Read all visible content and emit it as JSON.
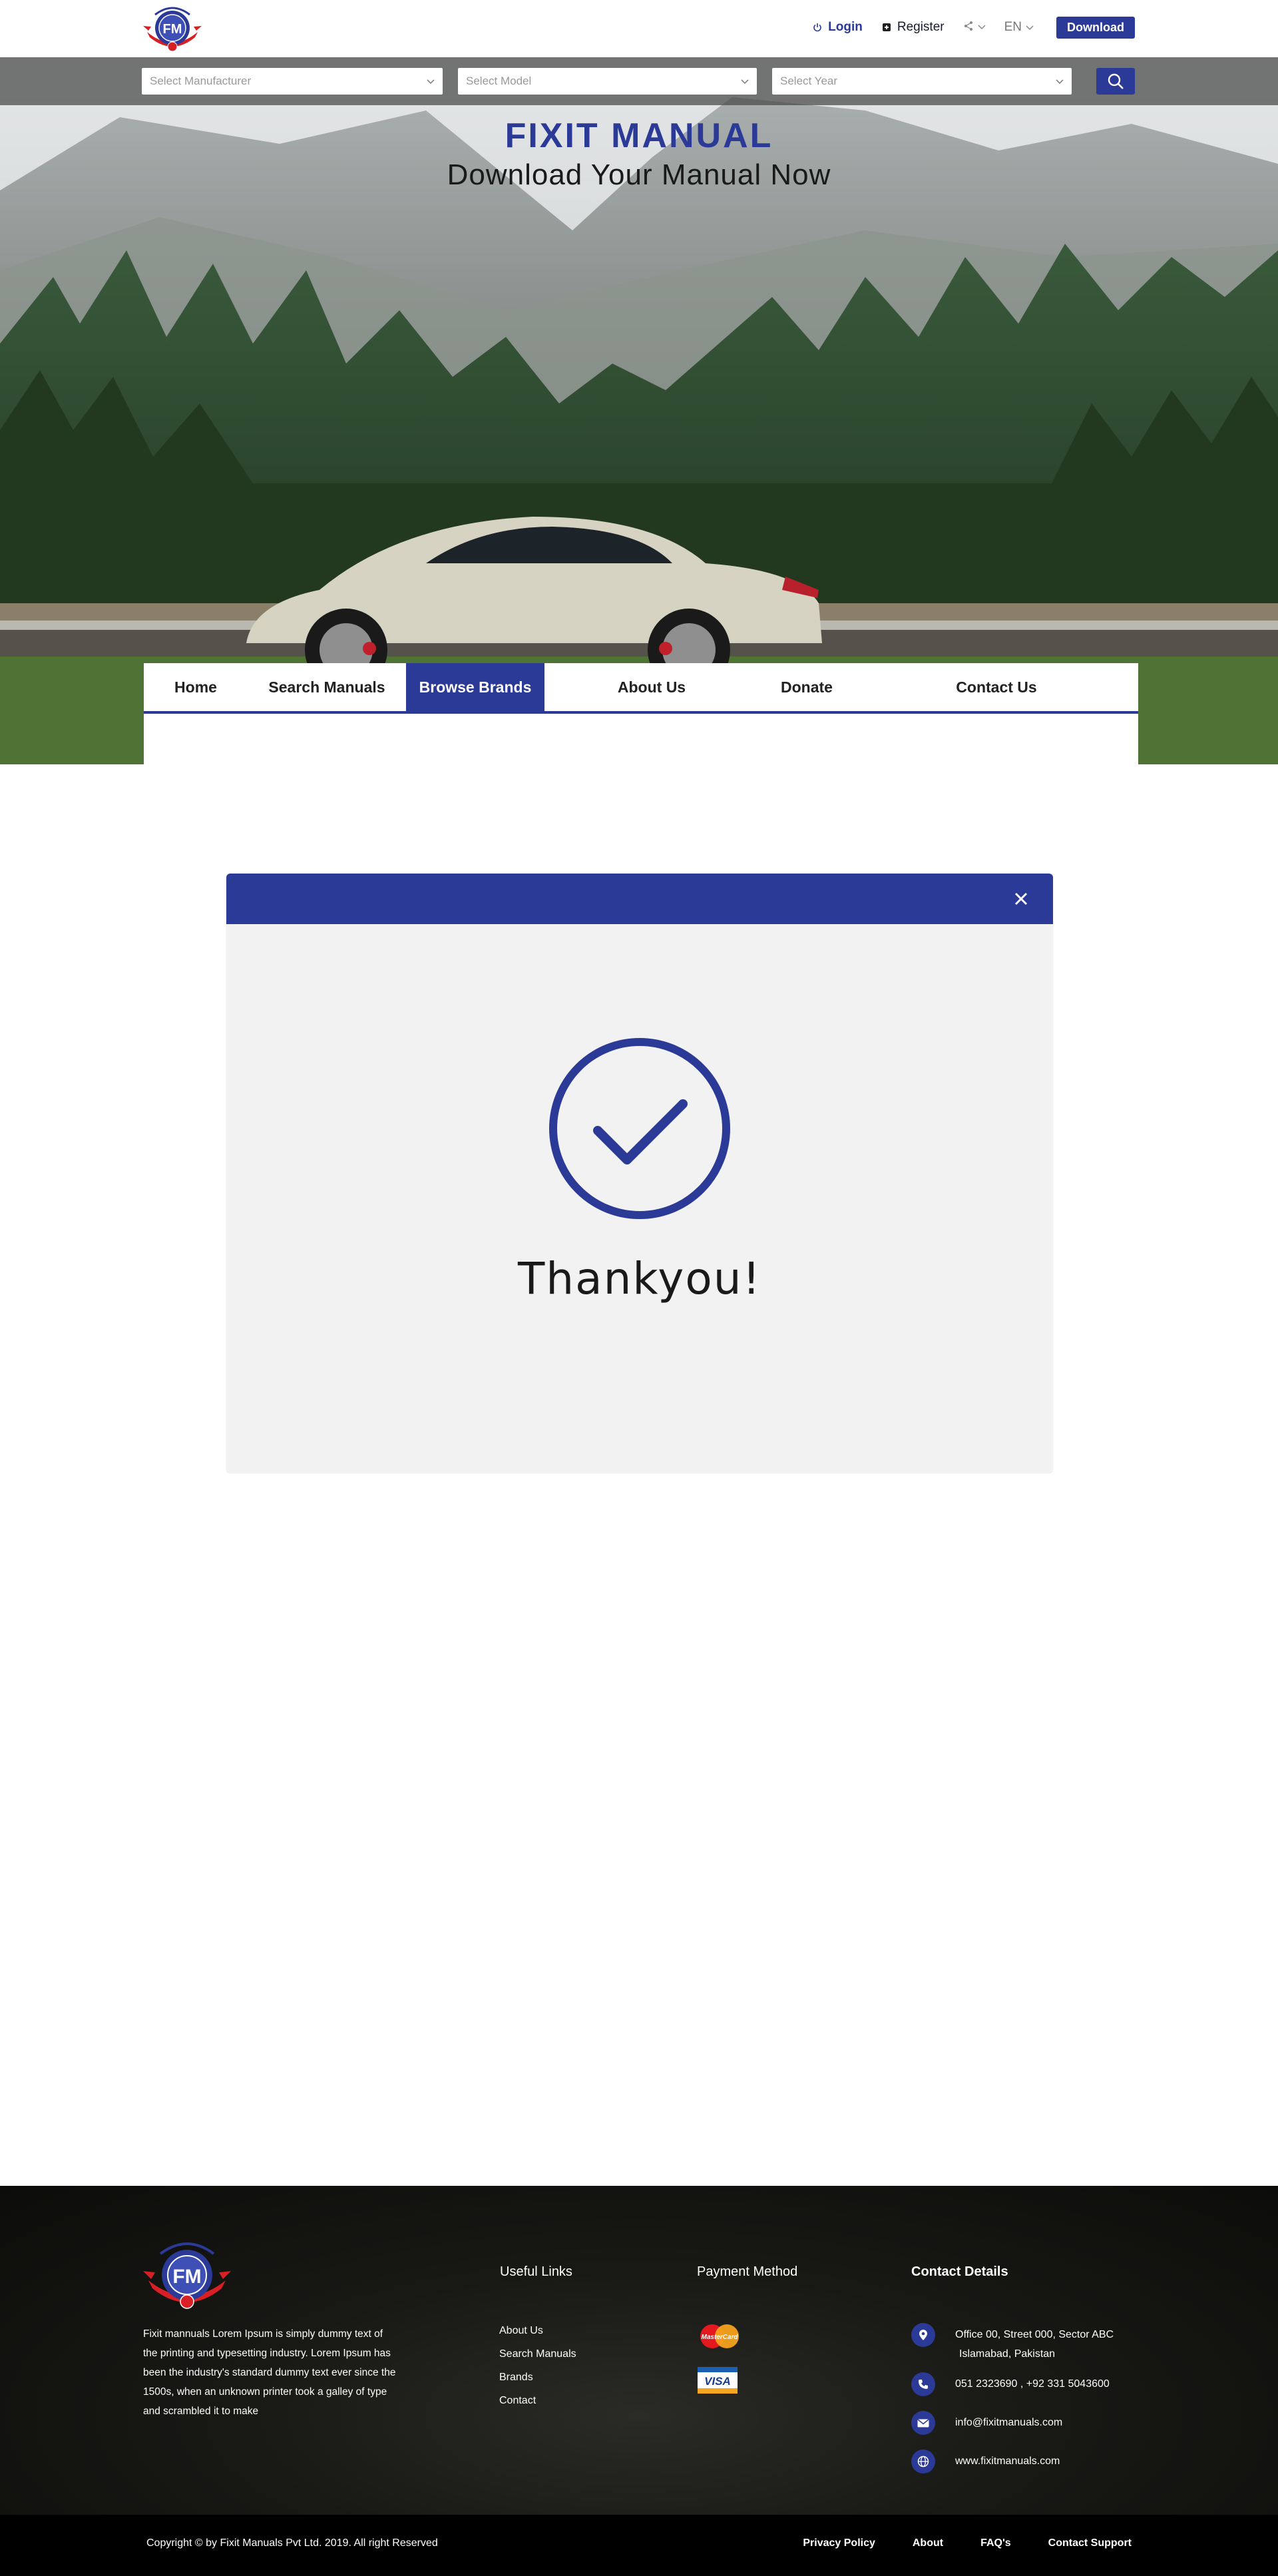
{
  "header": {
    "logo_alt": "Fixit Manuals",
    "login_label": "Login",
    "register_label": "Register",
    "language": "EN",
    "download_label": "Download"
  },
  "search": {
    "manufacturer_placeholder": "Select Manufacturer",
    "model_placeholder": "Select Model",
    "year_placeholder": "Select Year"
  },
  "hero": {
    "title": "FIXIT MANUAL",
    "subtitle": "Download Your Manual Now"
  },
  "nav": {
    "items": [
      {
        "label": "Home"
      },
      {
        "label": "Search Manuals"
      },
      {
        "label": "Browse Brands"
      },
      {
        "label": "About Us"
      },
      {
        "label": "Donate"
      },
      {
        "label": "Contact Us"
      }
    ],
    "active": "Browse Brands"
  },
  "modal": {
    "message": "Thankyou!"
  },
  "footer": {
    "about": "Fixit mannuals Lorem Ipsum is simply dummy text of the printing and typesetting industry. Lorem Ipsum has been the industry's standard dummy text ever since the 1500s, when an unknown printer took a galley of type and scrambled it to make",
    "useful_links_title": "Useful Links",
    "useful_links": [
      "About Us",
      "Search Manuals",
      "Brands",
      "Contact"
    ],
    "payment_title": "Payment Method",
    "payment_methods": [
      "MasterCard",
      "VISA"
    ],
    "contact_title": "Contact Details",
    "address_line1": "Office 00, Street 000, Sector ABC",
    "address_line2": "Islamabad, Pakistan",
    "phone": "051 2323690 , +92 331 5043600",
    "email": "info@fixitmanuals.com",
    "website": "www.fixitmanuals.com"
  },
  "bottom": {
    "copyright": "Copyright © by Fixit Manuals Pvt Ltd. 2019. All right Reserved",
    "links": [
      "Privacy Policy",
      "About",
      "FAQ's",
      "Contact Support"
    ]
  },
  "colors": {
    "brand": "#2b3a97",
    "accent_red": "#d81f26"
  },
  "icons": [
    "power-icon",
    "plus-square-icon",
    "share-icon",
    "chevron-down-icon",
    "search-icon",
    "close-icon",
    "check-circle-icon",
    "location-icon",
    "phone-icon",
    "mail-icon",
    "globe-icon"
  ]
}
